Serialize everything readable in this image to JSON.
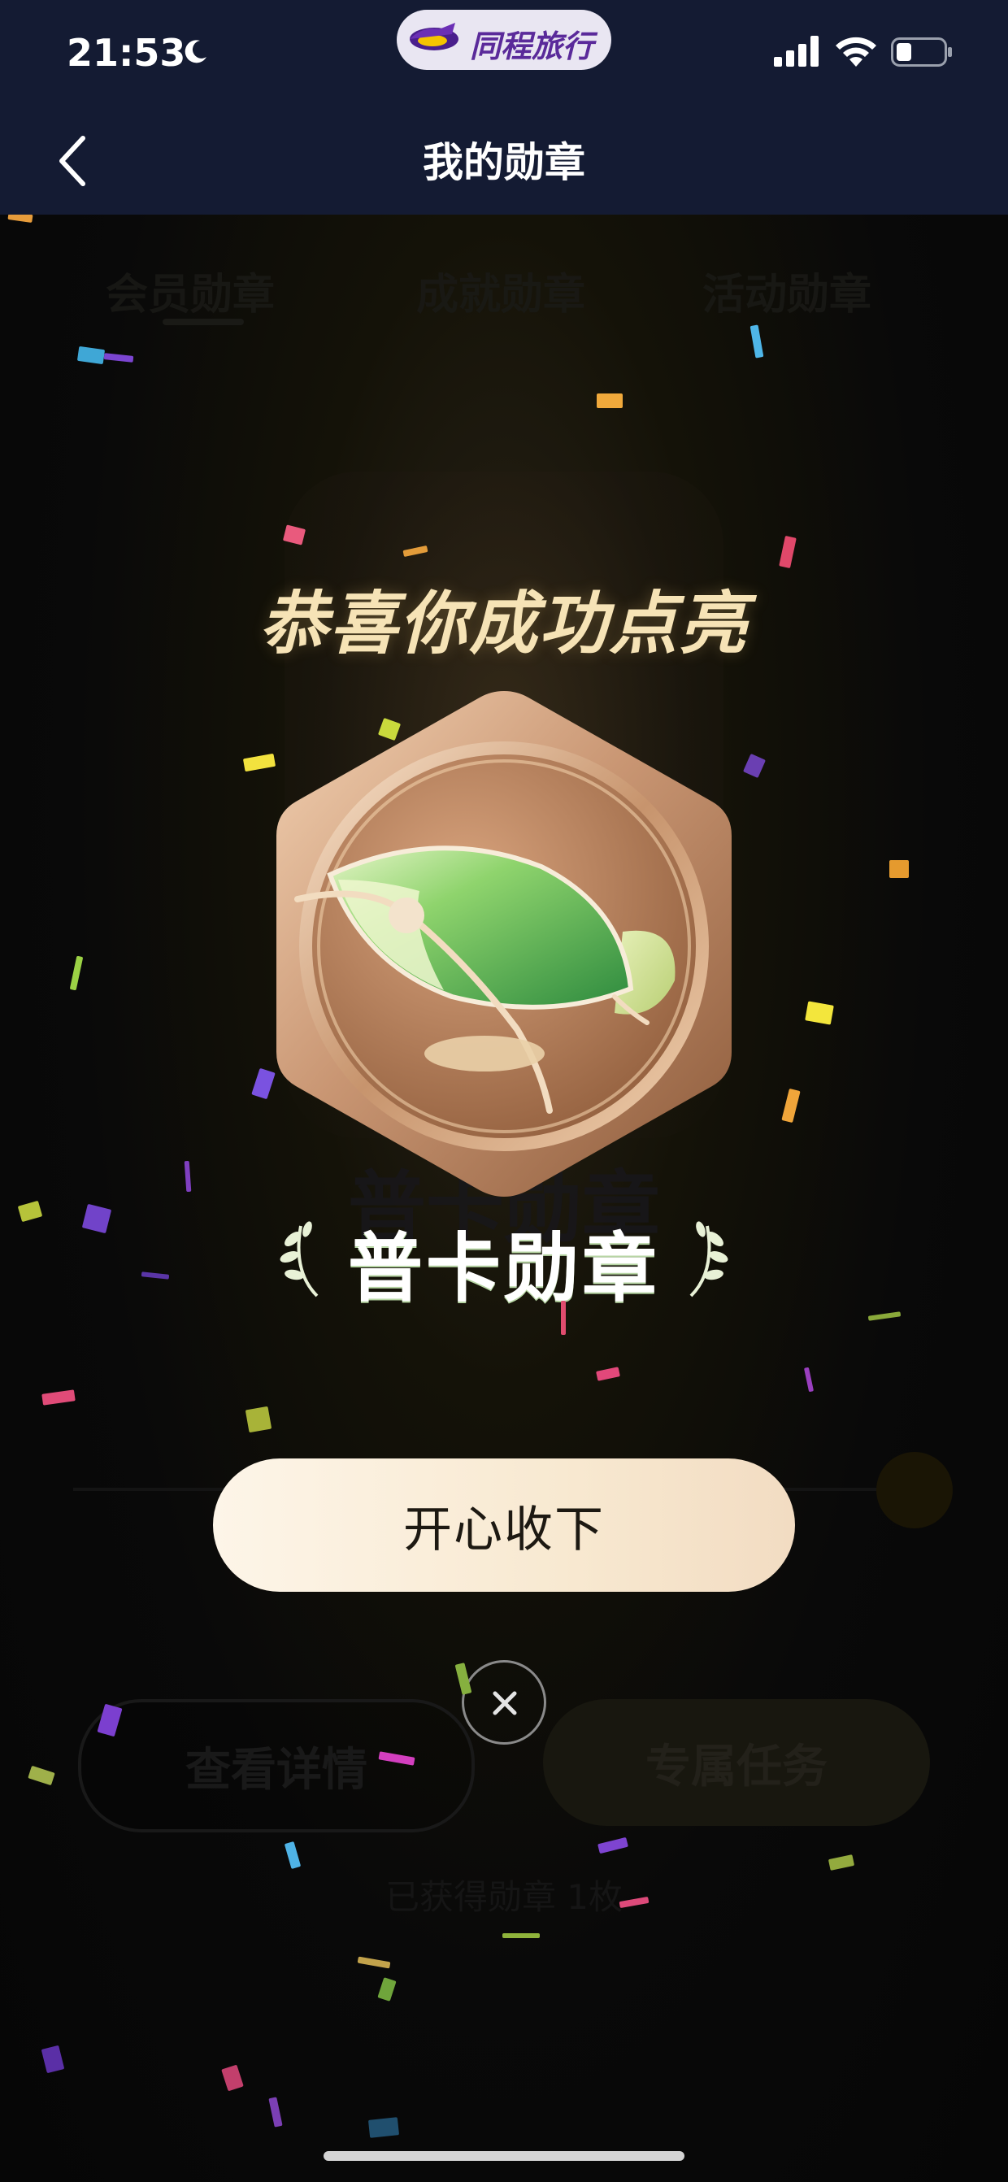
{
  "status_bar": {
    "time": "21:53",
    "app_name": "同程旅行"
  },
  "nav": {
    "title": "我的勋章"
  },
  "background": {
    "tabs": [
      "会员勋章",
      "成就勋章",
      "活动勋章"
    ],
    "badge_title": "普卡勋章",
    "buttons": {
      "details": "查看详情",
      "tasks": "专属任务"
    },
    "footer_text": "已获得勋章 1枚"
  },
  "modal": {
    "title": "恭喜你成功点亮",
    "badge_name": "普卡勋章",
    "accept_button": "开心收下"
  },
  "colors": {
    "top_bar": "#141b33",
    "title_gold": "#f6e3b6",
    "button_cream": "#f8e9d1",
    "badge_bronze": "#b8855e",
    "leaf_green": "#4caf50"
  }
}
